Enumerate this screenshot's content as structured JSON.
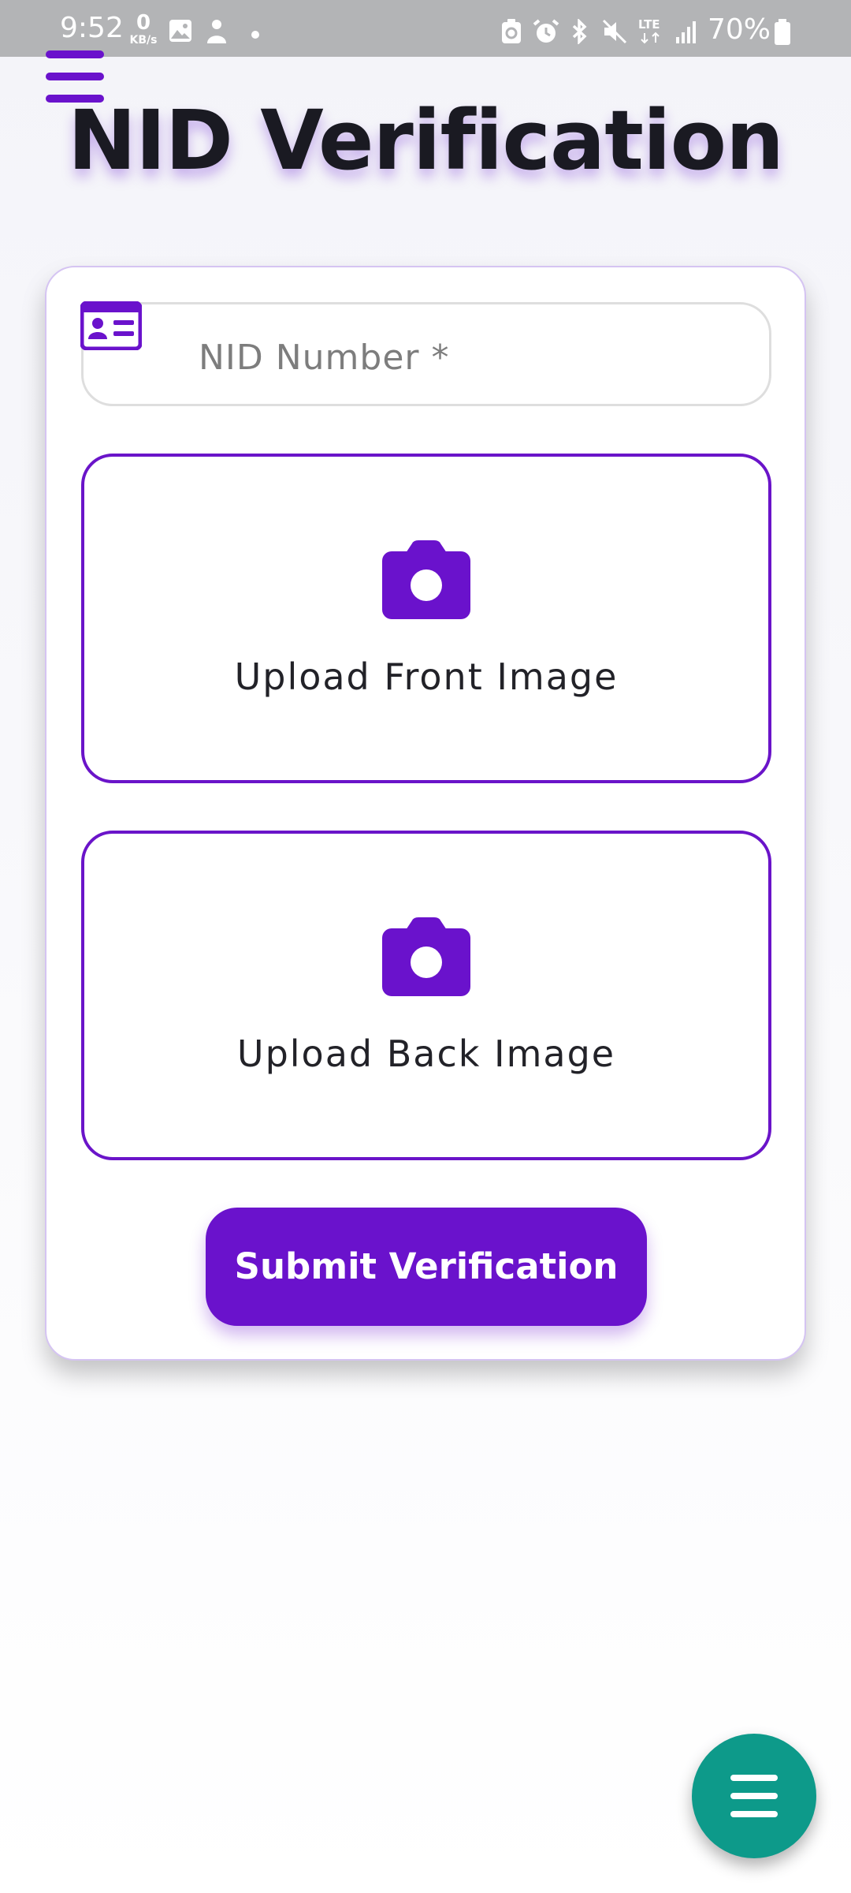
{
  "status_bar": {
    "time": "9:52",
    "data_speed": "0",
    "data_speed_unit": "KB/s",
    "network": "LTE",
    "battery": "70%"
  },
  "header": {
    "menu_icon": "hamburger-menu-icon",
    "title": "NID Verification"
  },
  "form": {
    "nid_field": {
      "icon": "id-card-icon",
      "placeholder": "NID Number *",
      "value": ""
    },
    "front_upload": {
      "icon": "camera-icon",
      "label": "Upload Front Image"
    },
    "back_upload": {
      "icon": "camera-icon",
      "label": "Upload Back Image"
    },
    "submit_label": "Submit Verification"
  },
  "fab": {
    "icon": "menu-icon"
  },
  "colors": {
    "accent": "#6a12cc",
    "fab": "#0d9a8a",
    "status_bar": "#b3b4b6",
    "title_text": "#1a1a22"
  }
}
